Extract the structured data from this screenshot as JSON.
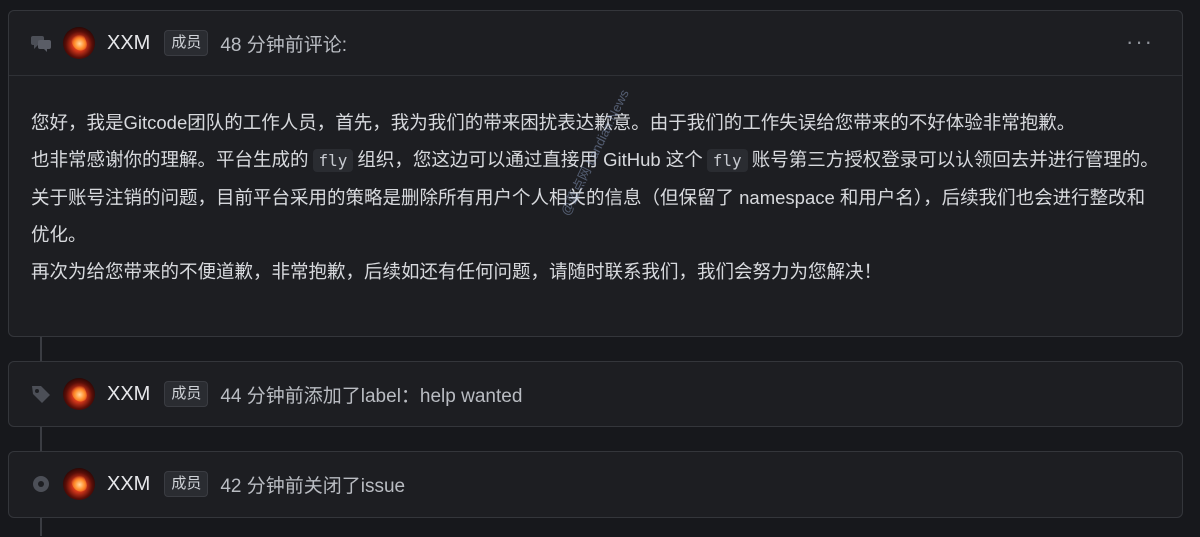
{
  "comment": {
    "username": "XXM",
    "role_badge": "成员",
    "meta": "48 分钟前评论:",
    "more_label": "···",
    "lines": {
      "line1": "您好，我是Gitcode团队的工作人员，首先，我为我们的带来困扰表达歉意。由于我们的工作失误给您带来的不好体验非常抱歉。",
      "line2_prefix": "也非常感谢你的理解。平台生成的",
      "code1": "fly",
      "line2_middle": "组织，您这边可以通过直接用 GitHub 这个",
      "code2": "fly",
      "line2_suffix": "账号第三方授权登录可以认领回去并进行管理的。",
      "line3": "关于账号注销的问题，目前平台采用的策略是删除所有用户个人相关的信息（但保留了 namespace 和用户名），后续我们也会进行整改和优化。",
      "line4": "再次为给您带来的不便道歉，非常抱歉，后续如还有任何问题，请随时联系我们，我们会努力为您解决！"
    }
  },
  "events": [
    {
      "icon": "tag-icon",
      "username": "XXM",
      "role_badge": "成员",
      "text": "44 分钟前添加了label：help wanted"
    },
    {
      "icon": "closed-issue-icon",
      "username": "XXM",
      "role_badge": "成员",
      "text": "42 分钟前关闭了issue"
    }
  ],
  "watermark": "@蓝点网 Landian.News"
}
